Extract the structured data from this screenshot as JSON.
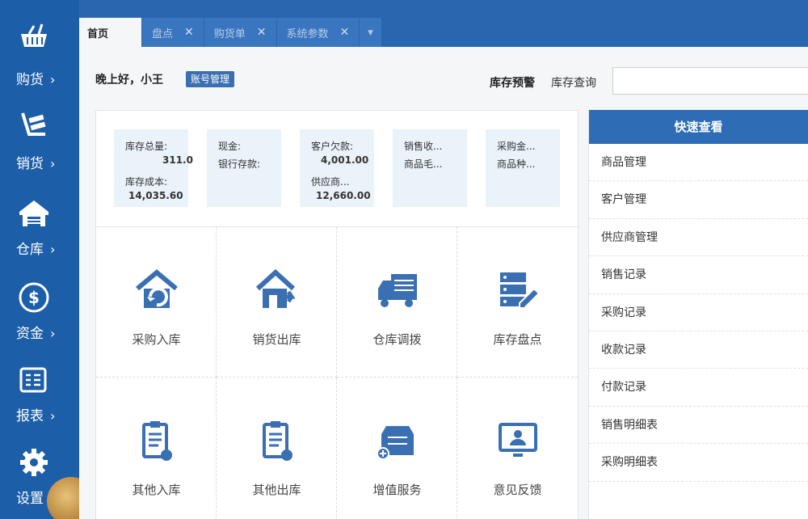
{
  "sidebar": {
    "items": [
      {
        "label": "购货",
        "chevron": "›",
        "icon": "basket-icon"
      },
      {
        "label": "销货",
        "chevron": "›",
        "icon": "cart-icon"
      },
      {
        "label": "仓库",
        "chevron": "›",
        "icon": "warehouse-icon"
      },
      {
        "label": "资金",
        "chevron": "›",
        "icon": "dollar-icon"
      },
      {
        "label": "报表",
        "chevron": "›",
        "icon": "report-icon"
      },
      {
        "label": "设置",
        "chevron": "",
        "icon": "gear-icon"
      }
    ]
  },
  "tabs": [
    {
      "label": "首页",
      "close": ""
    },
    {
      "label": "盘点",
      "close": "✕"
    },
    {
      "label": "购货单",
      "close": "✕"
    },
    {
      "label": "系统参数",
      "close": "✕"
    }
  ],
  "tab_dropdown": "▾",
  "header": {
    "greeting": "晚上好，小王",
    "account_button": "账号管理",
    "stock_warning": "库存预警",
    "stock_query": "库存查询"
  },
  "stats": [
    {
      "l1": "库存总量:",
      "v1": "311.0",
      "l2": "库存成本:",
      "v2": "14,035.60"
    },
    {
      "l1": "现金:",
      "v1": "",
      "l2": "银行存款:",
      "v2": ""
    },
    {
      "l1": "客户欠款:",
      "v1": "4,001.00",
      "l2": "供应商...",
      "v2": "12,660.00"
    },
    {
      "l1": "销售收...",
      "v1": "",
      "l2": "商品毛...",
      "v2": ""
    },
    {
      "l1": "采购金...",
      "v1": "",
      "l2": "商品种...",
      "v2": ""
    }
  ],
  "actions": [
    {
      "label": "采购入库",
      "icon": "house-in-icon"
    },
    {
      "label": "销货出库",
      "icon": "house-out-icon"
    },
    {
      "label": "仓库调拨",
      "icon": "truck-icon"
    },
    {
      "label": "库存盘点",
      "icon": "server-edit-icon"
    },
    {
      "label": "其他入库",
      "icon": "clipboard-in-icon"
    },
    {
      "label": "其他出库",
      "icon": "clipboard-out-icon"
    },
    {
      "label": "增值服务",
      "icon": "box-plus-icon"
    },
    {
      "label": "意见反馈",
      "icon": "monitor-user-icon"
    }
  ],
  "quick": {
    "title": "快速查看",
    "items": [
      "商品管理",
      "客户管理",
      "供应商管理",
      "销售记录",
      "采购记录",
      "收款记录",
      "付款记录",
      "销售明细表",
      "采购明细表"
    ]
  },
  "colors": {
    "sidebar": "#1d5ea9",
    "accent": "#2e6cb5",
    "icon": "#3a6fb2"
  }
}
